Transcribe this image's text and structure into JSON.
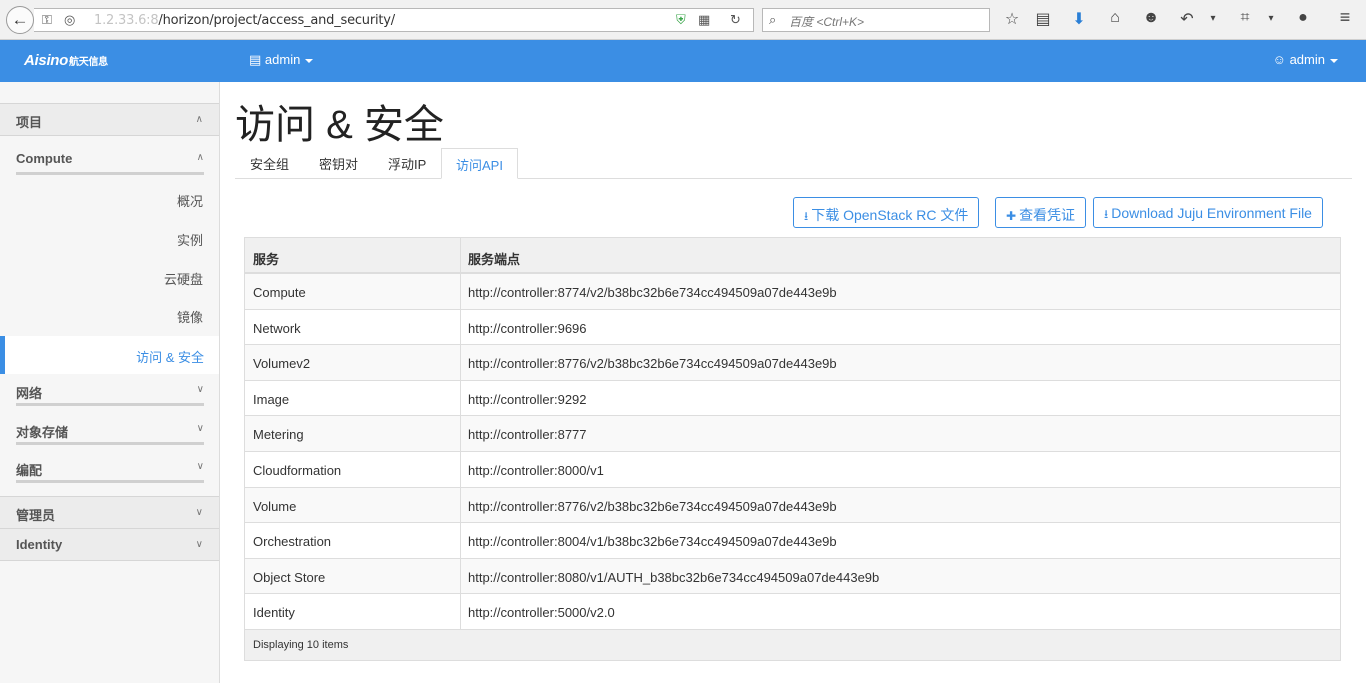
{
  "browser": {
    "url_host_blur": "1.2.33.6:8",
    "url_path": "/horizon/project/access_and_security/",
    "search_placeholder": "百度 <Ctrl+K>"
  },
  "header": {
    "brand": "Aisino",
    "brand_sub": "航天信息",
    "project_label": "admin",
    "user_label": "admin"
  },
  "sidebar": {
    "project_title": "项目",
    "compute_title": "Compute",
    "compute_items": [
      "概况",
      "实例",
      "云硬盘",
      "镜像"
    ],
    "active_item": "访问 & 安全",
    "network": "网络",
    "object_storage": "对象存储",
    "orchestration": "编配",
    "admin": "管理员",
    "identity": "Identity"
  },
  "page": {
    "title": "访问 & 安全",
    "tabs": [
      "安全组",
      "密钥对",
      "浮动IP",
      "访问API"
    ],
    "buttons": {
      "download_rc": "下载 OpenStack RC 文件",
      "view_credentials": "查看凭证",
      "download_juju": "Download Juju Environment File"
    }
  },
  "table": {
    "headers": [
      "服务",
      "服务端点"
    ],
    "rows": [
      {
        "service": "Compute",
        "endpoint": "http://controller:8774/v2/b38bc32b6e734cc494509a07de443e9b"
      },
      {
        "service": "Network",
        "endpoint": "http://controller:9696"
      },
      {
        "service": "Volumev2",
        "endpoint": "http://controller:8776/v2/b38bc32b6e734cc494509a07de443e9b"
      },
      {
        "service": "Image",
        "endpoint": "http://controller:9292"
      },
      {
        "service": "Metering",
        "endpoint": "http://controller:8777"
      },
      {
        "service": "Cloudformation",
        "endpoint": "http://controller:8000/v1"
      },
      {
        "service": "Volume",
        "endpoint": "http://controller:8776/v2/b38bc32b6e734cc494509a07de443e9b"
      },
      {
        "service": "Orchestration",
        "endpoint": "http://controller:8004/v1/b38bc32b6e734cc494509a07de443e9b"
      },
      {
        "service": "Object Store",
        "endpoint": "http://controller:8080/v1/AUTH_b38bc32b6e734cc494509a07de443e9b"
      },
      {
        "service": "Identity",
        "endpoint": "http://controller:5000/v2.0"
      }
    ],
    "footer": "Displaying 10 items"
  },
  "colors": {
    "accent": "#3b8ee4"
  }
}
